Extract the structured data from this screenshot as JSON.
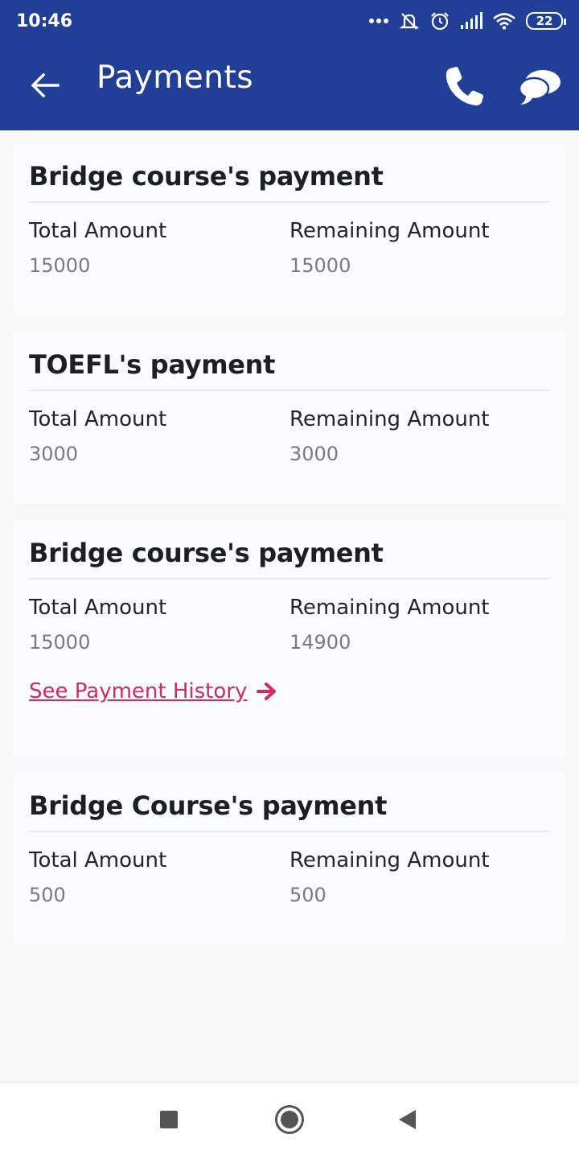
{
  "status_bar": {
    "time": "10:46",
    "battery": "22",
    "icons": [
      "more-dots-icon",
      "mute-icon",
      "alarm-icon",
      "signal-icon",
      "wifi-icon",
      "battery-icon"
    ]
  },
  "app_bar": {
    "title": "Payments",
    "color": "#223f98",
    "icons": [
      "back-arrow-icon",
      "phone-icon",
      "chat-icon"
    ]
  },
  "payments": [
    {
      "title": "Bridge course's payment",
      "total_label": "Total Amount",
      "total_value": "15000",
      "remaining_label": "Remaining Amount",
      "remaining_value": "15000"
    },
    {
      "title": "TOEFL's payment",
      "total_label": "Total Amount",
      "total_value": "3000",
      "remaining_label": "Remaining Amount",
      "remaining_value": "3000"
    },
    {
      "title": "Bridge course's payment",
      "total_label": "Total Amount",
      "total_value": "15000",
      "remaining_label": "Remaining Amount",
      "remaining_value": "14900",
      "history_link": "See Payment History"
    },
    {
      "title": "Bridge Course's payment",
      "total_label": "Total Amount",
      "total_value": "500",
      "remaining_label": "Remaining Amount",
      "remaining_value": "500"
    }
  ],
  "link_color": "#d42a62",
  "nav_bar": {
    "icons": [
      "recents-square-icon",
      "home-circle-icon",
      "back-triangle-icon"
    ]
  }
}
